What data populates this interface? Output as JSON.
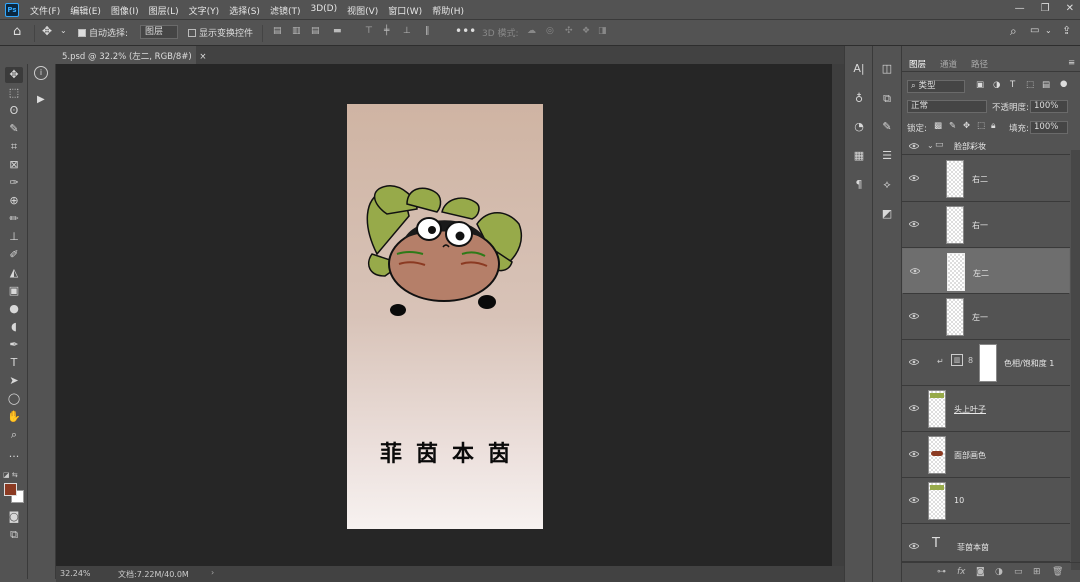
{
  "menubar": {
    "logo": "Ps",
    "items": [
      "文件(F)",
      "编辑(E)",
      "图像(I)",
      "图层(L)",
      "文字(Y)",
      "选择(S)",
      "滤镜(T)",
      "3D(D)",
      "视图(V)",
      "窗口(W)",
      "帮助(H)"
    ],
    "window_buttons": [
      "—",
      "❐",
      "✕"
    ]
  },
  "options": {
    "auto_select_label": "自动选择:",
    "auto_select_value": "图层",
    "show_transform_label": "显示变换控件",
    "mode_3d_label": "3D 模式:"
  },
  "document": {
    "tab_title": "5.psd @ 32.2% (左二, RGB/8#)",
    "zoom": "32.24%",
    "doc_size": "文档:7.22M/40.0M",
    "canvas_text": "菲茵本茵"
  },
  "layers_panel": {
    "tabs": [
      "图层",
      "通道",
      "路径"
    ],
    "filter_kind": "类型",
    "blend_mode": "正常",
    "opacity_label": "不透明度:",
    "opacity_value": "100%",
    "lock_label": "锁定:",
    "fill_label": "填充:",
    "fill_value": "100%",
    "group_name": "脸部彩妆",
    "layers": [
      {
        "name": "右二"
      },
      {
        "name": "右一"
      },
      {
        "name": "左二"
      },
      {
        "name": "左一"
      },
      {
        "name": "色相/饱和度 1"
      },
      {
        "name": "头上叶子"
      },
      {
        "name": "面部画色"
      },
      {
        "name": "10"
      },
      {
        "name": "菲茵本茵"
      }
    ]
  },
  "colors": {
    "foreground": "#8b3a22",
    "background": "#ffffff",
    "accent": "#31a8ff"
  }
}
